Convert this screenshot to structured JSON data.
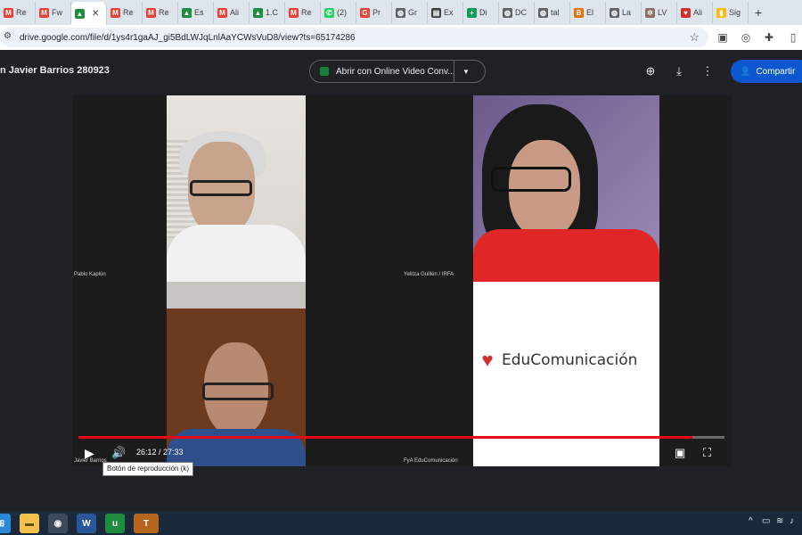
{
  "browser": {
    "tabs": [
      {
        "label": "Re",
        "icon": "gmail-icon",
        "color": "#ea4335",
        "glyph": "M"
      },
      {
        "label": "Fw",
        "icon": "gmail-icon",
        "color": "#ea4335",
        "glyph": "M"
      },
      {
        "label": "",
        "icon": "google-drive-icon",
        "color": "#1e8e3e",
        "glyph": "▲",
        "active": true
      },
      {
        "label": "Re",
        "icon": "gmail-icon",
        "color": "#ea4335",
        "glyph": "M"
      },
      {
        "label": "Re",
        "icon": "gmail-icon",
        "color": "#ea4335",
        "glyph": "M"
      },
      {
        "label": "Es",
        "icon": "google-drive-icon",
        "color": "#1e8e3e",
        "glyph": "▲"
      },
      {
        "label": "Ali",
        "icon": "gmail-icon",
        "color": "#ea4335",
        "glyph": "M"
      },
      {
        "label": "1.C",
        "icon": "google-drive-icon",
        "color": "#1e8e3e",
        "glyph": "▲"
      },
      {
        "label": "Re",
        "icon": "gmail-icon",
        "color": "#ea4335",
        "glyph": "M"
      },
      {
        "label": "(2)",
        "icon": "whatsapp-icon",
        "color": "#25d366",
        "glyph": "✆"
      },
      {
        "label": "Pr",
        "icon": "google-icon",
        "color": "#ea4335",
        "glyph": "G"
      },
      {
        "label": "Gr",
        "icon": "globe-icon",
        "color": "#5f6368",
        "glyph": "◍"
      },
      {
        "label": "Ex",
        "icon": "doc-icon",
        "color": "#3c4043",
        "glyph": "▤"
      },
      {
        "label": "Di",
        "icon": "sheets-plus-icon",
        "color": "#0f9d58",
        "glyph": "+"
      },
      {
        "label": "DC",
        "icon": "globe-icon",
        "color": "#5f6368",
        "glyph": "◍"
      },
      {
        "label": "tal",
        "icon": "globe-icon",
        "color": "#5f6368",
        "glyph": "◍"
      },
      {
        "label": "El",
        "icon": "news-icon",
        "color": "#e8710a",
        "glyph": "B"
      },
      {
        "label": "La",
        "icon": "globe-icon",
        "color": "#5f6368",
        "glyph": "◍"
      },
      {
        "label": "LV",
        "icon": "leaf-icon",
        "color": "#8d6e63",
        "glyph": "✲"
      },
      {
        "label": "Ali",
        "icon": "heart-logo-icon",
        "color": "#d32f2f",
        "glyph": "♥"
      },
      {
        "label": "Sig",
        "icon": "bars-icon",
        "color": "#fbbc04",
        "glyph": "▮"
      }
    ],
    "new_tab": "+",
    "close_tab": "✕",
    "url": "drive.google.com/file/d/1ys4r1gaAJ_gi5BdLWJqLnlAaYCWsVuD8/view?ts=65174286"
  },
  "viewer": {
    "title": "n Javier Barrios 280923",
    "open_with": "Abrir con Online Video Conv...",
    "share": "Compartir"
  },
  "video": {
    "participants": [
      {
        "name": "Pablo Kaplún"
      },
      {
        "name": "Yelitza Guillén / IRFA"
      },
      {
        "name": "Javier Barrios"
      },
      {
        "name": "FyA EduComunicación"
      }
    ],
    "brand_text": "EduComunicación",
    "time": "26:12 / 27:33",
    "progress": 0.951,
    "tooltip": "Botón de reproducción (k)"
  },
  "colors": {
    "progress": "#e50914",
    "share": "#0b57d0"
  }
}
